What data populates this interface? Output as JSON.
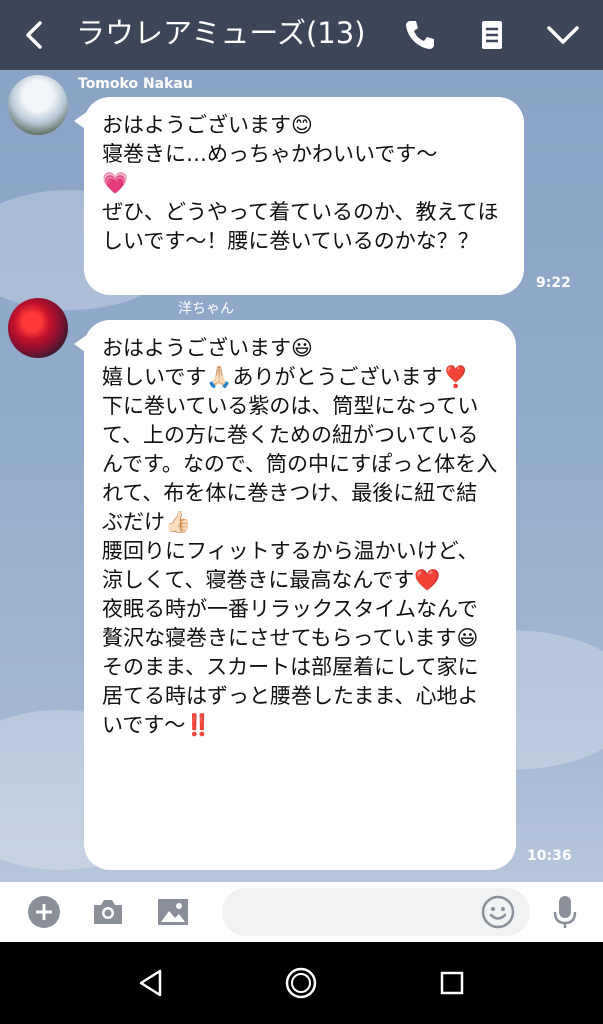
{
  "header": {
    "title": "ラウレアミューズ(13)"
  },
  "messages": [
    {
      "sender": "Tomoko Nakau",
      "text": "おはようございます😊\n寝巻きに…めっちゃかわいいです〜\n💗\nぜひ、どうやって着ているのか、教えてほしいです〜！腰に巻いているのかな？？",
      "time": "9:22"
    },
    {
      "sender": "洋ちゃん",
      "text": "おはようございます😃\n嬉しいです🙏🏻ありがとうございます❣️\n下に巻いている紫のは、筒型になっていて、上の方に巻くための紐がついているんです。なので、筒の中にすぽっと体を入れて、布を体に巻きつけ、最後に紐で結ぶだけ👍🏻\n腰回りにフィットするから温かいけど、涼しくて、寝巻きに最高なんです❤️\n夜眠る時が一番リラックスタイムなんで贅沢な寝巻きにさせてもらっています😃\nそのまま、スカートは部屋着にして家に居てる時はずっと腰巻したまま、心地よいです〜‼️",
      "time": "10:36"
    }
  ],
  "icons": {
    "header": [
      "back-icon",
      "phone-icon",
      "note-icon",
      "chevron-down-icon"
    ],
    "input": [
      "plus-icon",
      "camera-icon",
      "image-icon",
      "emoji-icon",
      "mic-icon"
    ],
    "nav": [
      "nav-back-icon",
      "nav-home-icon",
      "nav-recent-icon"
    ]
  },
  "colors": {
    "header_bg": "#3d4659",
    "chat_bg": "#8fa7c9",
    "bubble_bg": "#ffffff",
    "icon_gray": "#8a8f99"
  }
}
